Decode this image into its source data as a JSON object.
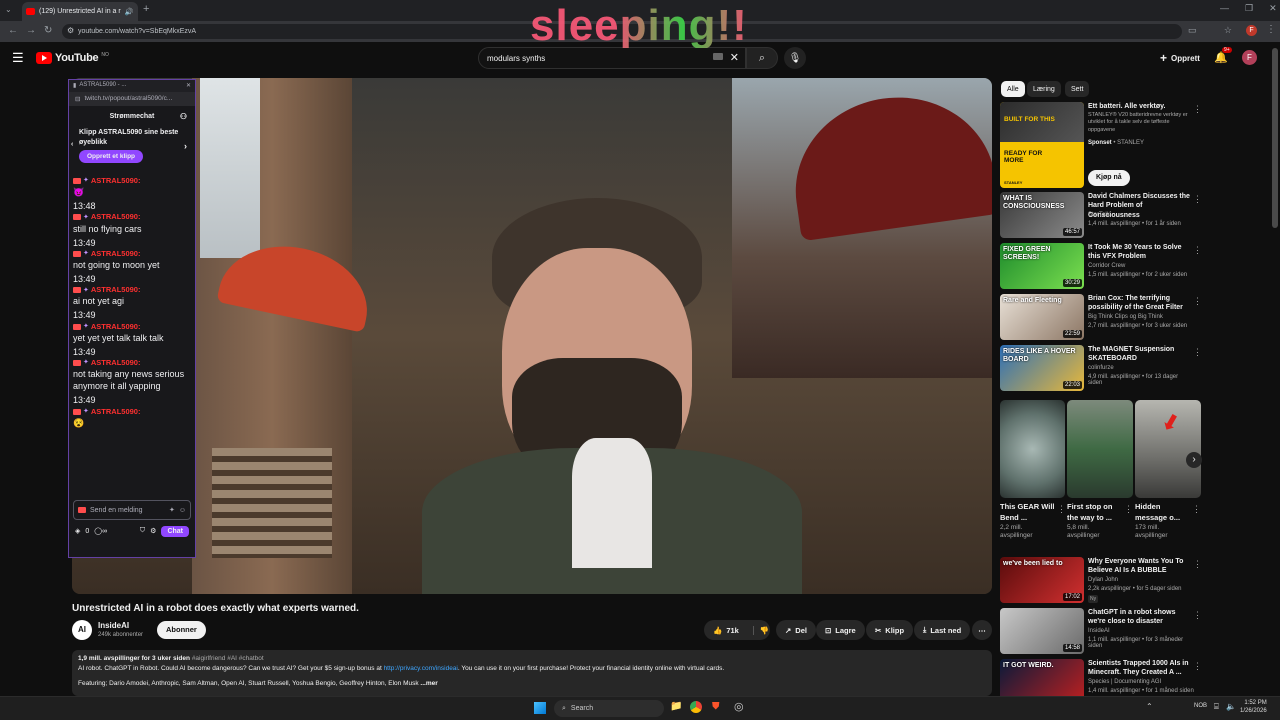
{
  "browser": {
    "tab_title": "(129) Unrestricted AI in a r",
    "url": "youtube.com/watch?v=SbEqMkxEzvA"
  },
  "overlay_text": "sleeping!!",
  "header": {
    "logo": "YouTube",
    "logo_region": "NO",
    "search_value": "modulars synths",
    "create_label": "Opprett",
    "notif_count": "9+",
    "avatar_letter": "F"
  },
  "chat_popup": {
    "window_title": "ASTRAL5090 - ...",
    "url": "twitch.tv/popout/astral5090/c...",
    "header": "Strømmechat",
    "clip_prompt": "Klipp ASTRAL5090 sine beste øyeblikk",
    "clip_button": "Opprett et klipp",
    "messages": [
      {
        "user": "ASTRAL5090:",
        "time": "",
        "text": "😈"
      },
      {
        "user": "ASTRAL5090:",
        "time": "13:48",
        "text": "still no flying cars"
      },
      {
        "user": "ASTRAL5090:",
        "time": "13:49",
        "text": "not going to moon yet"
      },
      {
        "user": "ASTRAL5090:",
        "time": "13:49",
        "text": "ai not yet agi"
      },
      {
        "user": "ASTRAL5090:",
        "time": "13:49",
        "text": "yet yet yet talk talk talk"
      },
      {
        "user": "ASTRAL5090:",
        "time": "13:49",
        "text": "not taking any news serious anymore it all yapping"
      },
      {
        "user": "ASTRAL5090:",
        "time": "13:49",
        "text": "😵"
      }
    ],
    "input_placeholder": "Send en melding",
    "points": "0",
    "chat_button": "Chat"
  },
  "video": {
    "title": "Unrestricted AI in a robot does exactly what experts warned."
  },
  "channel": {
    "avatar_text": "AI",
    "name": "InsideAI",
    "subscribers": "249k abonnenter",
    "subscribe_label": "Abonner"
  },
  "actions": {
    "likes": "71k",
    "share": "Del",
    "save": "Lagre",
    "clip": "Klipp",
    "download": "Last ned"
  },
  "description": {
    "stats": "1,9 mill. avspillinger  for 3 uker siden",
    "tags": "#aigirlfriend #AI #chatbot",
    "line1_prefix": "AI robot. ChatGPT in Robot. Could AI become dangerous? Can we trust AI? Get your $5 sign-up bonus at ",
    "line1_link": "http://privacy.com/insideai",
    "line1_suffix": ". You can use it on your first purchase! Protect your financial identity online with virtual cards.",
    "line2": "Featuring; Dario Amodei, Anthropic, Sam Altman, Open AI, Stuart Russell, Yoshua Bengio, Geoffrey Hinton, Elon Musk",
    "more": "...mer"
  },
  "chips": [
    "Alle",
    "Læring",
    "Sett"
  ],
  "ad": {
    "title": "Ett batteri. Alle verktøy.",
    "desc": "STANLEY® V20 batteridrevne verktøy er utviklet for å takle selv de tøffeste oppgavene",
    "sponsor": "Sponset",
    "advertiser": "STANLEY",
    "cta": "Kjøp nå",
    "thumb_text1": "BUILT FOR THIS",
    "thumb_text2": "READY FOR MORE",
    "thumb_brand": "STANLEY"
  },
  "recommendations": [
    {
      "title": "David Chalmers Discusses the Hard Problem of Consciousness",
      "channel": "StarTalk",
      "meta": "1,4 mill. avspillinger • for 1 år siden",
      "duration": "46:57",
      "thumb_text": "WHAT IS CONSCIOUSNESS"
    },
    {
      "title": "It Took Me 30 Years to Solve this VFX Problem",
      "channel": "Corridor Crew",
      "meta": "1,5 mill. avspillinger • for 2 uker siden",
      "duration": "30:29",
      "thumb_text": "FIXED GREEN SCREENS!"
    },
    {
      "title": "Brian Cox: The terrifying possibility of the Great Filter",
      "channel": "Big Think Clips og Big Think",
      "meta": "2,7 mill. avspillinger • for 3 uker siden",
      "duration": "22:59",
      "thumb_text": "Rare and Fleeting"
    },
    {
      "title": "The MAGNET Suspension SKATEBOARD",
      "channel": "colinfurze",
      "meta": "4,9 mill. avspillinger • for 13 dager siden",
      "duration": "22:03",
      "thumb_text": "RIDES LIKE A HOVER BOARD"
    }
  ],
  "shorts": [
    {
      "title": "This GEAR Will Bend ...",
      "views": "2,2 mill. avspillinger"
    },
    {
      "title": "First stop on the way to ...",
      "views": "5,8 mill. avspillinger"
    },
    {
      "title": "Hidden message o...",
      "views": "173 mill. avspillinger"
    }
  ],
  "recommendations2": [
    {
      "title": "Why Everyone Wants You To Believe AI Is A BUBBLE",
      "channel": "Dylan John",
      "meta": "2,2k avspillinger • for 5 dager siden",
      "badge": "Ny",
      "duration": "17:02",
      "thumb_text": "we've been lied to"
    },
    {
      "title": "ChatGPT in a robot shows we're close to disaster",
      "channel": "InsideAI",
      "meta": "1,1 mill. avspillinger • for 3 måneder siden",
      "duration": "14:58",
      "thumb_text": ""
    },
    {
      "title": "Scientists Trapped 1000 AIs in Minecraft. They Created A ...",
      "channel": "Species | Documenting AGI",
      "meta": "1,4 mill. avspillinger • for 1 måned siden",
      "duration": "",
      "thumb_text": "IT GOT WEIRD."
    }
  ],
  "taskbar": {
    "search_placeholder": "Search",
    "lang": "NOB",
    "time": "1:52 PM",
    "date": "1/26/2026"
  }
}
